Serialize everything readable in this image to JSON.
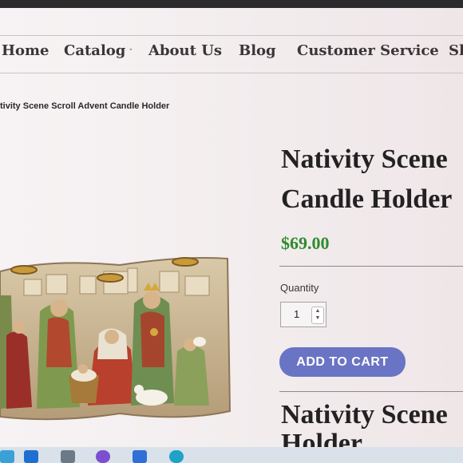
{
  "nav": {
    "items": [
      "Home",
      "Catalog",
      "About Us",
      "Blog",
      "Customer Service",
      "Sh"
    ],
    "catalog_chevron": "˅"
  },
  "breadcrumb": "tivity Scene Scroll Advent Candle Holder",
  "product": {
    "title_line1": "Nativity Scene",
    "title_line2": "Candle Holder",
    "price": "$69.00",
    "price_color": "#2e8b2e",
    "quantity_label": "Quantity",
    "quantity_value": "1",
    "add_to_cart_label": "ADD TO CART",
    "button_color": "#6a74c4",
    "description_title_line1": "Nativity Scene",
    "description_title_line2": "Holder"
  },
  "taskbar": {
    "icons": [
      "search-icon",
      "mail-icon",
      "calculator-icon",
      "copilot-icon",
      "store-icon",
      "edge-icon"
    ]
  }
}
